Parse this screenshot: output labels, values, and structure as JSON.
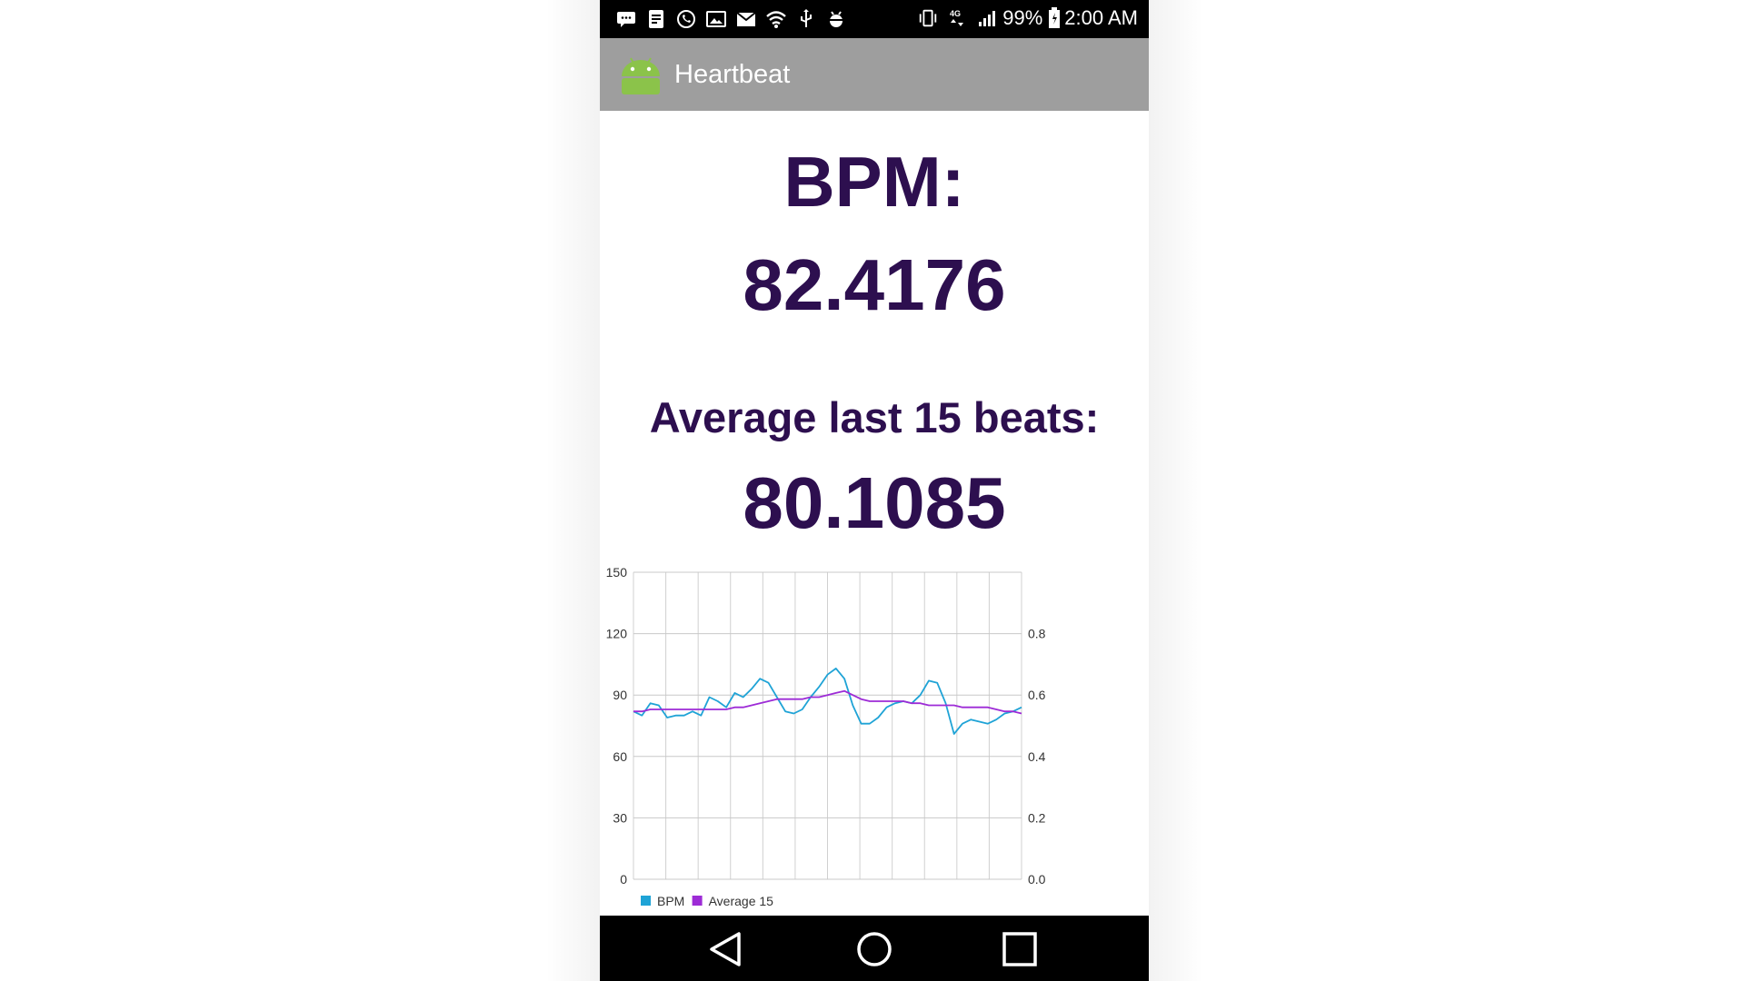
{
  "statusbar": {
    "battery": "99%",
    "time": "2:00 AM",
    "icons_left": [
      "chat-icon",
      "document-icon",
      "whatsapp-icon",
      "image-icon",
      "mail-icon",
      "wifi-icon",
      "usb-icon",
      "android-debug-icon"
    ],
    "icons_right": [
      "vibrate-icon",
      "network-4g-icon",
      "signal-icon",
      "battery-icon"
    ]
  },
  "appbar": {
    "title": "Heartbeat",
    "logo_icon": "android-icon",
    "color": "#9e9e9e"
  },
  "readings": {
    "bpm_label": "BPM:",
    "bpm_value": "82.4176",
    "avg_label": "Average last 15 beats:",
    "avg_value": "80.1085",
    "text_color": "#2d0f4f"
  },
  "chart_data": {
    "type": "line",
    "y_left_ticks": [
      "0",
      "30",
      "60",
      "90",
      "120",
      "150"
    ],
    "y_right_ticks": [
      "0.0",
      "0.2",
      "0.4",
      "0.6",
      "0.8"
    ],
    "ylim": [
      0,
      150
    ],
    "grid": true,
    "legend_position": "bottom-left",
    "series": [
      {
        "name": "BPM",
        "color": "#1fa3d6",
        "values": [
          82,
          80,
          86,
          85,
          79,
          80,
          80,
          82,
          80,
          89,
          87,
          84,
          91,
          89,
          93,
          98,
          96,
          89,
          82,
          81,
          83,
          89,
          94,
          100,
          103,
          98,
          85,
          76,
          76,
          79,
          84,
          86,
          87,
          86,
          90,
          97,
          96,
          86,
          71,
          76,
          78,
          77,
          76,
          78,
          81,
          82,
          84
        ]
      },
      {
        "name": "Average 15",
        "color": "#9d2bd6",
        "values": [
          82,
          82,
          83,
          83,
          83,
          83,
          83,
          83,
          83,
          83,
          83,
          83,
          84,
          84,
          85,
          86,
          87,
          88,
          88,
          88,
          88,
          89,
          89,
          90,
          91,
          92,
          90,
          88,
          87,
          87,
          87,
          87,
          87,
          86,
          86,
          85,
          85,
          85,
          85,
          84,
          84,
          84,
          84,
          83,
          82,
          82,
          81
        ]
      }
    ]
  },
  "navbar": {
    "back_icon": "back-icon",
    "home_icon": "home-icon",
    "recents_icon": "recents-icon"
  }
}
